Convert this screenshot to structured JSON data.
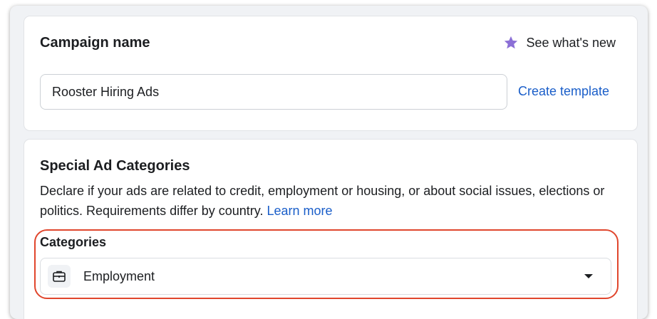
{
  "campaign_name": {
    "title": "Campaign name",
    "whats_new_label": "See what's new",
    "input_value": "Rooster Hiring Ads",
    "create_template_label": "Create template",
    "star_color": "#8b6fd6"
  },
  "special_ad_categories": {
    "title": "Special Ad Categories",
    "description": "Declare if your ads are related to credit, employment or housing, or about social issues, elections or politics. Requirements differ by country.",
    "learn_more_label": "Learn more",
    "categories_label": "Categories",
    "selected_category": "Employment",
    "selected_icon": "briefcase-icon",
    "highlight_color": "#e0462d"
  }
}
